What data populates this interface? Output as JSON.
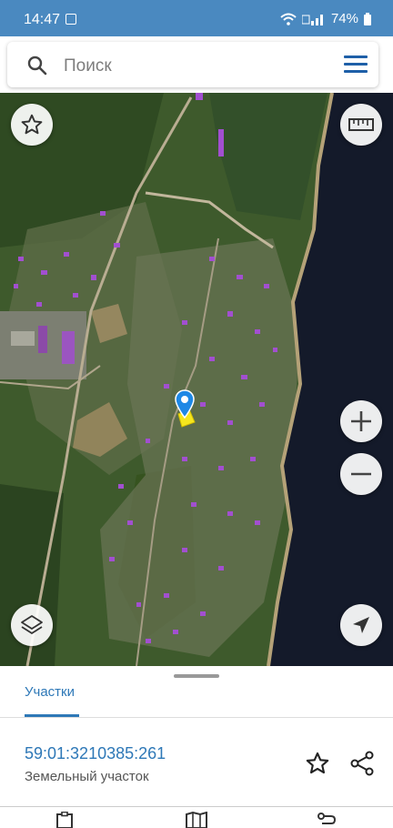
{
  "status_bar": {
    "time": "14:47",
    "battery": "74%"
  },
  "search": {
    "placeholder": "Поиск"
  },
  "map": {
    "controls": [
      "favorites",
      "ruler",
      "zoom-in",
      "zoom-out",
      "layers",
      "my-location"
    ],
    "marker_color": "#1e88e5"
  },
  "panel": {
    "tab_label": "Участки",
    "parcel": {
      "cadastral_number": "59:01:3210385:261",
      "type": "Земельный участок"
    }
  },
  "colors": {
    "accent": "#2e78b7",
    "status_bar": "#4a89c0"
  }
}
